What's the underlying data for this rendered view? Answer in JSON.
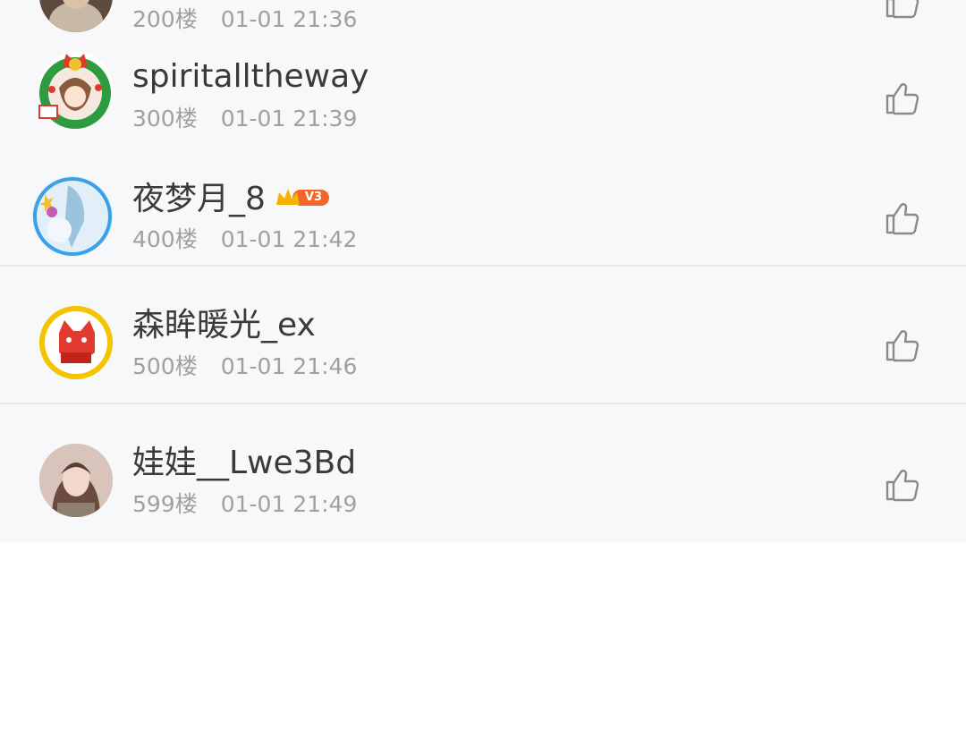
{
  "comments": [
    {
      "name": "",
      "floor": "200楼",
      "time": "01-01 21:36",
      "avatar": "brown-portrait-avatar"
    },
    {
      "name": "spiritalltheway",
      "floor": "300楼",
      "time": "01-01 21:39",
      "avatar": "christmas-wreath-anime-avatar"
    },
    {
      "name": "夜梦月_8",
      "floor": "400楼",
      "time": "01-01 21:42",
      "avatar": "blue-anime-avatar",
      "vip_level": "V3"
    },
    {
      "name": "森眸暖光_ex",
      "floor": "500楼",
      "time": "01-01 21:46",
      "avatar": "red-fox-cartoon-avatar"
    },
    {
      "name": "娃娃__Lwe3Bd",
      "floor": "599楼",
      "time": "01-01 21:49",
      "avatar": "girl-photo-avatar"
    }
  ],
  "colors": {
    "row_background": "#f7f8fa",
    "name_text": "#3a3a3a",
    "meta_text": "#a0a0a0",
    "vip_badge": "#f2662b",
    "crown": "#f6b400"
  }
}
